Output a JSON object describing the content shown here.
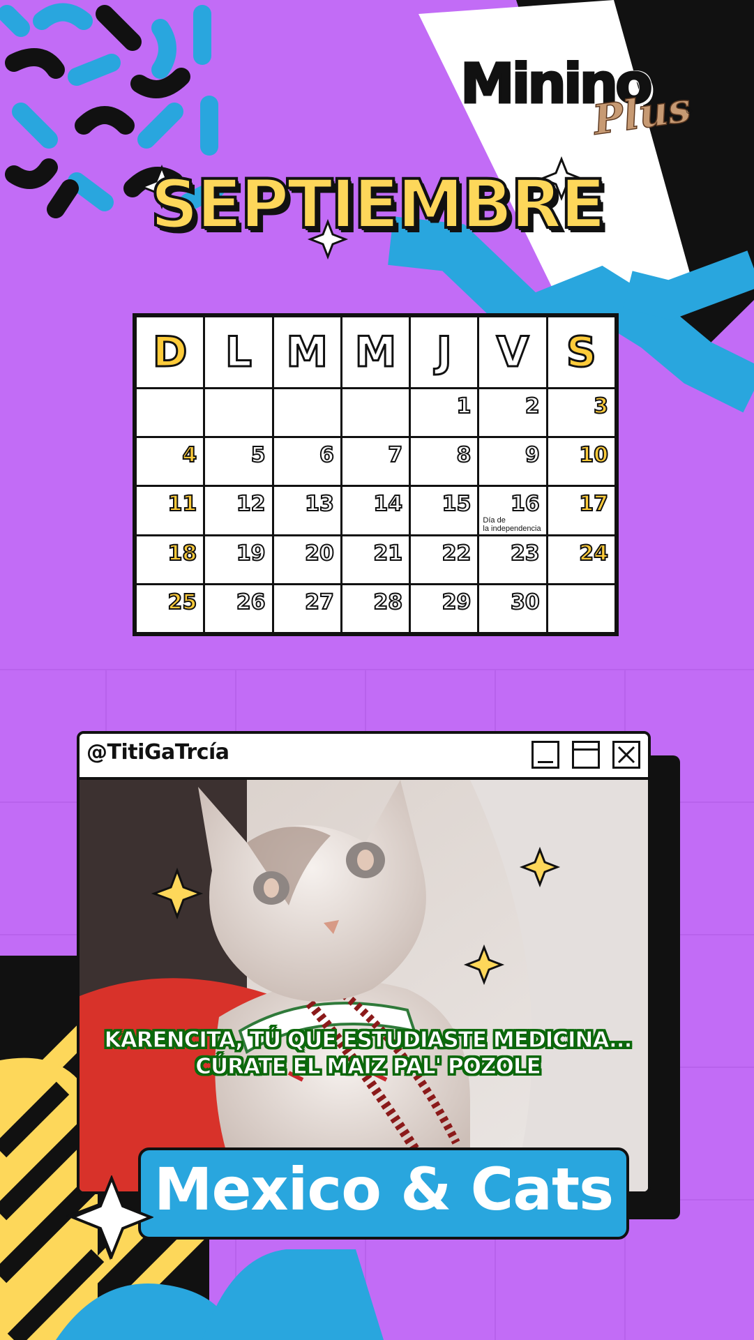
{
  "brand": {
    "name": "Minino",
    "sub": "Plus",
    "registered": "®"
  },
  "month_title": "SEPTIEMBRE",
  "calendar": {
    "day_headers": [
      {
        "label": "D",
        "weekend": true
      },
      {
        "label": "L",
        "weekend": false
      },
      {
        "label": "M",
        "weekend": false
      },
      {
        "label": "M",
        "weekend": false
      },
      {
        "label": "J",
        "weekend": false
      },
      {
        "label": "V",
        "weekend": false
      },
      {
        "label": "S",
        "weekend": true
      }
    ],
    "weeks": [
      [
        "",
        "",
        "",
        "",
        "1",
        "2",
        "3"
      ],
      [
        "4",
        "5",
        "6",
        "7",
        "8",
        "9",
        "10"
      ],
      [
        "11",
        "12",
        "13",
        "14",
        "15",
        "16",
        "17"
      ],
      [
        "18",
        "19",
        "20",
        "21",
        "22",
        "23",
        "24"
      ],
      [
        "25",
        "26",
        "27",
        "28",
        "29",
        "30",
        ""
      ]
    ],
    "notes": {
      "16": "Día de\nla independencia"
    }
  },
  "window": {
    "handle": "@TitiGaTrcía",
    "controls": [
      "minimize-icon",
      "maximize-icon",
      "close-icon"
    ]
  },
  "caption": {
    "line1": "KARENCITA, TÚ QUE ESTUDIASTE MEDICINA...",
    "line2": "CÚRATE EL MAIZ PAL' POZOLE"
  },
  "banner": {
    "text": "Mexico & Cats"
  },
  "colors": {
    "background": "#c26cf6",
    "yellow": "#fdcb3a",
    "blue": "#29a6de",
    "black": "#111111",
    "caption_outline": "#0b6a0b"
  }
}
